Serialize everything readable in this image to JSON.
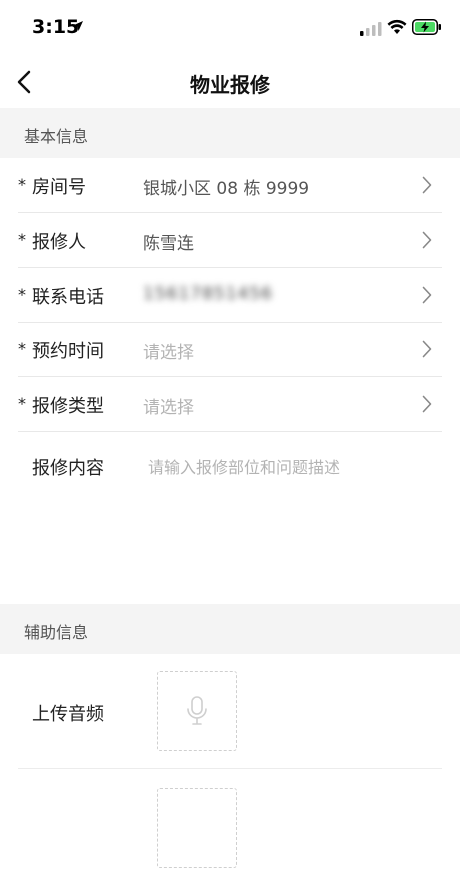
{
  "status_bar": {
    "time": "3:15"
  },
  "nav": {
    "title": "物业报修"
  },
  "sections": {
    "basic": "基本信息",
    "auxiliary": "辅助信息"
  },
  "form": {
    "required_mark": "*",
    "room": {
      "label": "房间号",
      "value": "银城小区 08 栋 9999"
    },
    "reporter": {
      "label": "报修人",
      "value": "陈雪连"
    },
    "phone": {
      "label": "联系电话",
      "value": "15617851456"
    },
    "appointment": {
      "label": "预约时间",
      "placeholder": "请选择"
    },
    "repair_type": {
      "label": "报修类型",
      "placeholder": "请选择"
    },
    "content": {
      "label": "报修内容",
      "placeholder": "请输入报修部位和问题描述"
    }
  },
  "auxiliary": {
    "audio": {
      "label": "上传音频",
      "icon": "microphone-icon"
    }
  },
  "colors": {
    "section_bg": "#f4f4f4",
    "placeholder": "#b3b3b3",
    "divider": "#e8e8e8"
  }
}
